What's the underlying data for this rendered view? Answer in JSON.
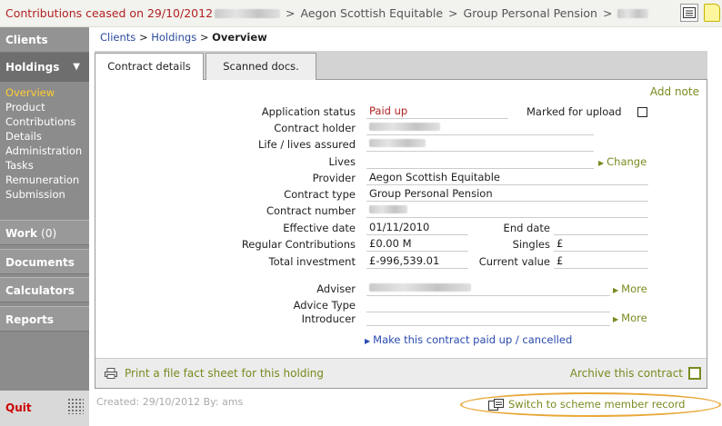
{
  "topbar": {
    "ceased": "Contributions ceased on 29/10/2012",
    "crumb_provider": "Aegon Scottish Equitable",
    "crumb_product": "Group Personal Pension",
    "separator": ">"
  },
  "sidebar": {
    "clients": "Clients",
    "holdings": "Holdings",
    "holdings_caret": "▼",
    "sub_items": [
      "Overview",
      "Product",
      "Contributions",
      "Details",
      "Administration",
      "Tasks",
      "Remuneration",
      "Submission"
    ],
    "work": "Work",
    "work_count": "(0)",
    "documents": "Documents",
    "calculators": "Calculators",
    "reports": "Reports",
    "quit": "Quit"
  },
  "breadcrumb": {
    "clients": "Clients",
    "holdings": "Holdings",
    "sep": ">",
    "current": "Overview"
  },
  "tabs": [
    "Contract details",
    "Scanned docs."
  ],
  "panel": {
    "add_note": "Add note",
    "labels": {
      "application_status": "Application status",
      "contract_holder": "Contract holder",
      "lives_assured": "Life / lives assured",
      "lives": "Lives",
      "provider": "Provider",
      "contract_type": "Contract type",
      "contract_number": "Contract number",
      "effective_date": "Effective date",
      "end_date": "End date",
      "regular_contributions": "Regular Contributions",
      "singles": "Singles",
      "total_investment": "Total investment",
      "current_value": "Current value",
      "adviser": "Adviser",
      "advice_type": "Advice Type",
      "introducer": "Introducer",
      "marked_for_upload": "Marked for upload"
    },
    "values": {
      "application_status": "Paid up",
      "provider": "Aegon Scottish Equitable",
      "contract_type": "Group Personal Pension",
      "effective_date": "01/11/2010",
      "regular_contributions": "£0.00  M",
      "singles": "£",
      "total_investment": "£-996,539.01",
      "current_value": "£"
    },
    "change_link": "Change",
    "more_link": "More",
    "paid_up_link": "Make this contract paid up / cancelled",
    "print_link": "Print a file fact sheet for this holding",
    "archive_link": "Archive this contract"
  },
  "footer": {
    "created": "Created: 29/10/2012 By: ams",
    "switch": "Switch to scheme member record"
  }
}
